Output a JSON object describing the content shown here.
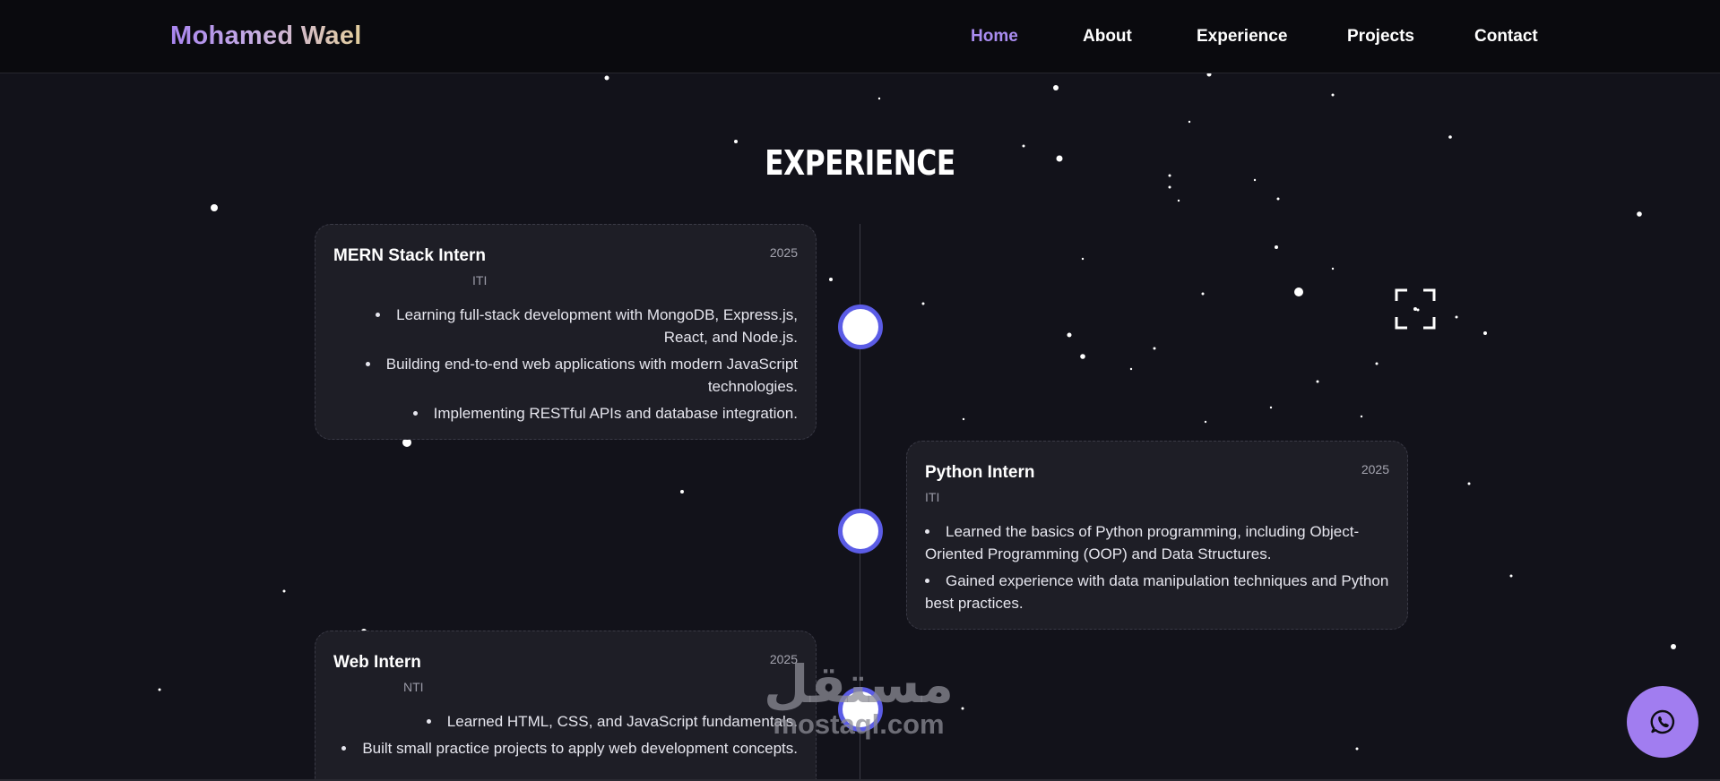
{
  "navbar": {
    "logo": "Mohamed Wael",
    "links": [
      {
        "label": "Home",
        "active": true
      },
      {
        "label": "About",
        "active": false
      },
      {
        "label": "Experience",
        "active": false
      },
      {
        "label": "Projects",
        "active": false
      },
      {
        "label": "Contact",
        "active": false
      }
    ]
  },
  "section": {
    "title": "EXPERIENCE"
  },
  "experience": [
    {
      "role": "MERN Stack Intern",
      "company": "ITI",
      "year": "2025",
      "points": [
        "Learning full-stack development with MongoDB, Express.js, React, and Node.js.",
        "Building end-to-end web applications with modern JavaScript technologies.",
        "Implementing RESTful APIs and database integration."
      ]
    },
    {
      "role": "Python Intern",
      "company": "ITI",
      "year": "2025",
      "points": [
        "Learned the basics of Python programming, including Object-Oriented Programming (OOP) and Data Structures.",
        "Gained experience with data manipulation techniques and Python best practices."
      ]
    },
    {
      "role": "Web Intern",
      "company": "NTI",
      "year": "2025",
      "points": [
        "Learned HTML, CSS, and JavaScript fundamentals.",
        "Built small practice projects to apply web development concepts."
      ]
    }
  ],
  "watermark": {
    "arabic": "مستقل",
    "latin": "mostaql.com"
  },
  "icons": {
    "whatsapp": "whatsapp-icon",
    "focus": "fullscreen-focus-icon",
    "timeline_dot": "timeline-dot"
  },
  "colors": {
    "background": "#12121a",
    "accent": "#a17df0",
    "active_link": "#a98cf0",
    "dot_border": "#5b5ce6",
    "card": "#1e1e26"
  }
}
